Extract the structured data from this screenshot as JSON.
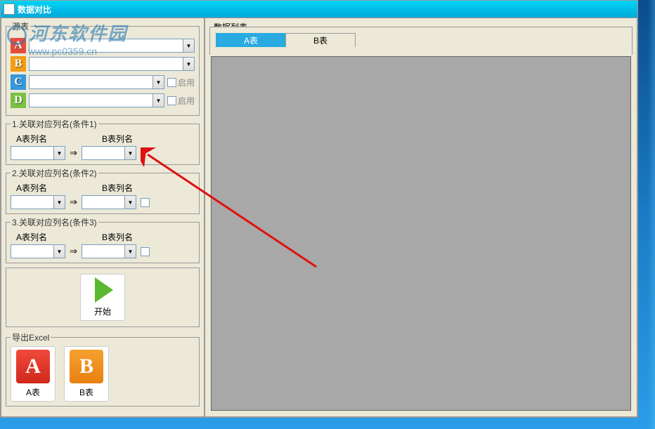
{
  "title": "数据对比",
  "watermark": {
    "text": "河东软件园",
    "url": "www.pc0359.cn"
  },
  "leftPanel": {
    "sourceGroup": "源表",
    "rows": {
      "A": "A",
      "B": "B",
      "C": "C",
      "D": "D"
    },
    "enableLabel": "启用",
    "link1": {
      "title": "1.关联对应列名(条件1)",
      "colA": "A表列名",
      "colB": "B表列名"
    },
    "link2": {
      "title": "2.关联对应列名(条件2)",
      "colA": "A表列名",
      "colB": "B表列名"
    },
    "link3": {
      "title": "3.关联对应列名(条件3)",
      "colA": "A表列名",
      "colB": "B表列名"
    },
    "startLabel": "开始",
    "exportGroup": "导出Excel",
    "exportA": "A表",
    "exportB": "B表"
  },
  "rightPanel": {
    "groupLabel": "数据列表",
    "tabA": "A表",
    "tabB": "B表"
  }
}
